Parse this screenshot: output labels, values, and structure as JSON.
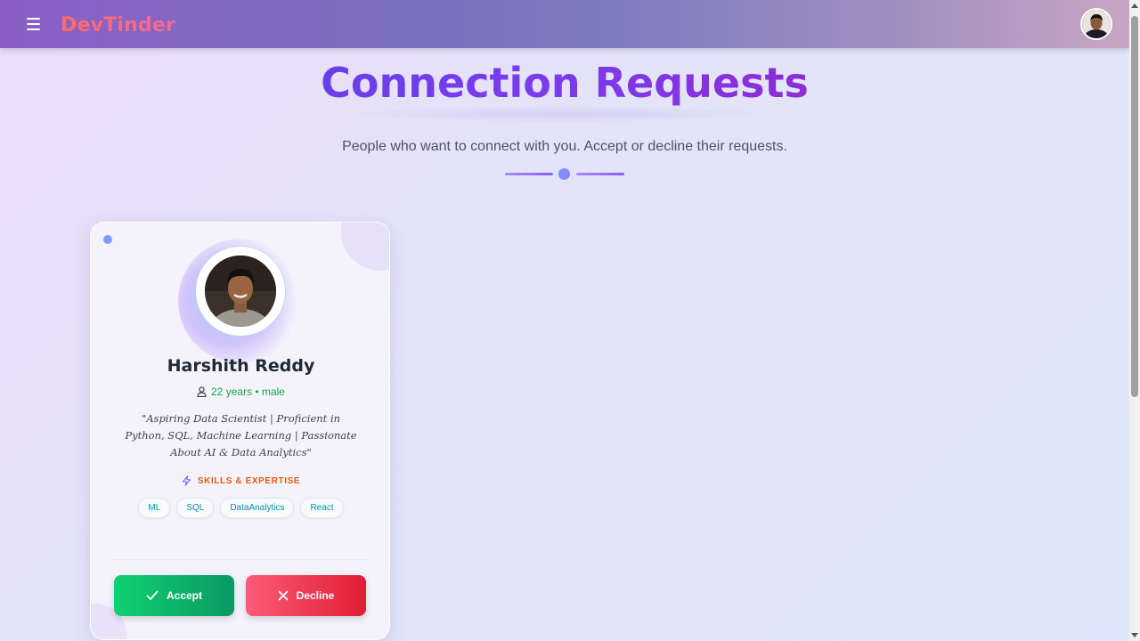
{
  "navbar": {
    "brand": "DevTinder",
    "menu_icon": "hamburger-menu-icon",
    "avatar_icon": "user-avatar"
  },
  "header": {
    "title": "Connection Requests",
    "subtitle": "People who want to connect with you. Accept or decline their requests."
  },
  "requests": [
    {
      "name": "Harshith Reddy",
      "meta": "22 years • male",
      "meta_icon": "user-icon",
      "bio": "\"Aspiring Data Scientist | Proficient in Python, SQL, Machine Learning | Passionate About AI & Data Analytics\"",
      "skills_title": "SKILLS & EXPERTISE",
      "skills_icon": "lightning-icon",
      "skills": [
        "ML",
        "SQL",
        "DataAnalytics",
        "React"
      ],
      "accept_label": "Accept",
      "decline_label": "Decline"
    }
  ],
  "colors": {
    "accept": "#10b981",
    "decline": "#ef4444",
    "title_start": "#4f46e5",
    "title_end": "#a21caf",
    "meta_text": "#16a34a",
    "skills_title": "#ea580c",
    "skill_text": "#0891b2"
  }
}
